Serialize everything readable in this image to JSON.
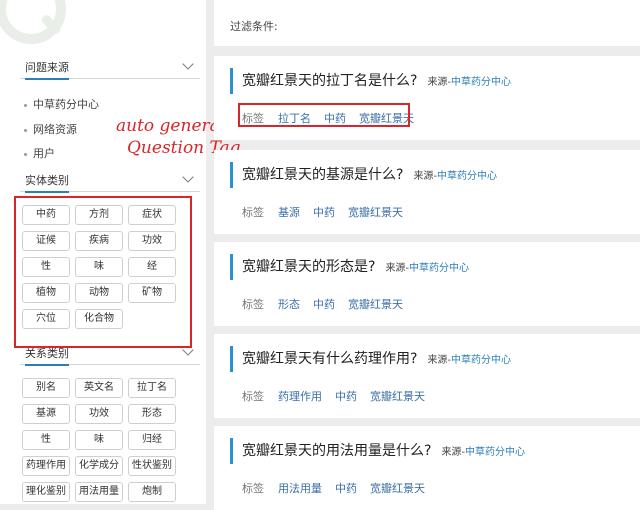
{
  "sidebar": {
    "source_section": {
      "title": "问题来源",
      "items": [
        "中草药分中心",
        "网络资源",
        "用户"
      ]
    },
    "entity_section": {
      "title": "实体类别",
      "items": [
        "中药",
        "方剂",
        "症状",
        "证候",
        "疾病",
        "功效",
        "性",
        "味",
        "经",
        "植物",
        "动物",
        "矿物",
        "穴位",
        "化合物"
      ]
    },
    "relation_section": {
      "title": "关系类别",
      "items": [
        "别名",
        "英文名",
        "拉丁名",
        "基源",
        "功效",
        "形态",
        "性",
        "味",
        "归经",
        "药理作用",
        "化学成分",
        "性状鉴别",
        "理化鉴别",
        "用法用量",
        "炮制"
      ]
    }
  },
  "annotation": {
    "line1": "auto generated",
    "line2": "Question Tag"
  },
  "filter": {
    "label": "过滤条件:"
  },
  "questions": [
    {
      "question": "宽瓣红景天的拉丁名是什么?",
      "source_label": "来源-",
      "source": "中草药分中心",
      "tag_label": "标签",
      "tags": [
        "拉丁名",
        "中药",
        "宽瓣红景天"
      ]
    },
    {
      "question": "宽瓣红景天的基源是什么?",
      "source_label": "来源-",
      "source": "中草药分中心",
      "tag_label": "标签",
      "tags": [
        "基源",
        "中药",
        "宽瓣红景天"
      ]
    },
    {
      "question": "宽瓣红景天的形态是?",
      "source_label": "来源-",
      "source": "中草药分中心",
      "tag_label": "标签",
      "tags": [
        "形态",
        "中药",
        "宽瓣红景天"
      ]
    },
    {
      "question": "宽瓣红景天有什么药理作用?",
      "source_label": "来源-",
      "source": "中草药分中心",
      "tag_label": "标签",
      "tags": [
        "药理作用",
        "中药",
        "宽瓣红景天"
      ]
    },
    {
      "question": "宽瓣红景天的用法用量是什么?",
      "source_label": "来源-",
      "source": "中草药分中心",
      "tag_label": "标签",
      "tags": [
        "用法用量",
        "中药",
        "宽瓣红景天"
      ]
    }
  ],
  "colors": {
    "accent": "#2c8fd0",
    "link": "#2c7fb8",
    "tag": "#3b6fa8",
    "annotation": "#d8262a"
  },
  "icons": {
    "section_toggle": "chevron-down-icon",
    "logo": "search-icon"
  }
}
